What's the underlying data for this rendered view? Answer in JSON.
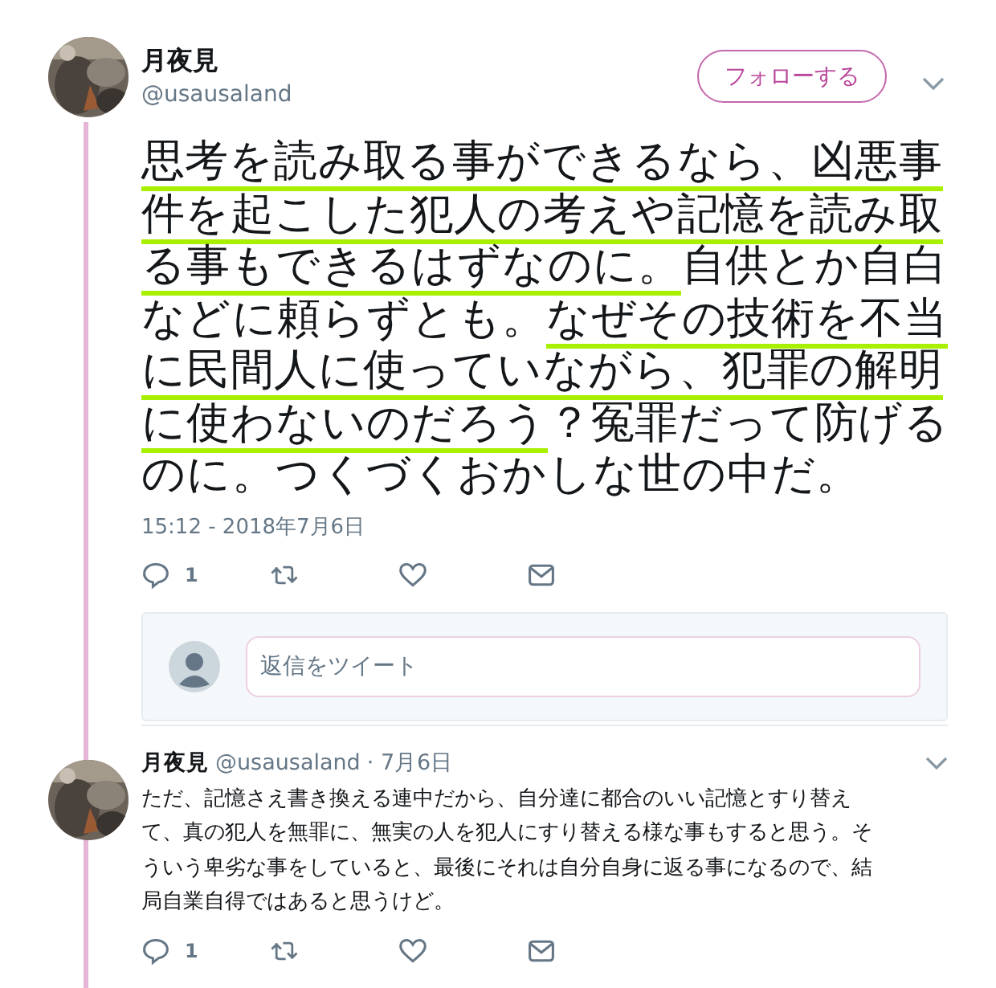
{
  "tweet": {
    "author": {
      "name": "月夜見",
      "handle": "@usausaland"
    },
    "follow_button": "フォローする",
    "text_lines": [
      [
        {
          "text": "思考を読み取る事ができるなら、凶悪事",
          "highlighted": true
        }
      ],
      [
        {
          "text": "件を起こした犯人の考えや記憶を読み取",
          "highlighted": true
        }
      ],
      [
        {
          "text": "る事もできるはずなのに。",
          "highlighted": true
        },
        {
          "text": "自供とか自白",
          "highlighted": false
        }
      ],
      [
        {
          "text": "などに頼らずとも。",
          "highlighted": false
        },
        {
          "text": "なぜその技術を不当",
          "highlighted": true
        }
      ],
      [
        {
          "text": "に民間人に使っていながら、犯罪の解明",
          "highlighted": true
        }
      ],
      [
        {
          "text": "に使わないのだろう",
          "highlighted": true
        },
        {
          "text": "？冤罪だって防げる",
          "highlighted": false
        }
      ],
      [
        {
          "text": "のに。つくづくおかしな世の中だ。",
          "highlighted": false
        }
      ]
    ],
    "timestamp": "15:12 - 2018年7月6日",
    "actions": {
      "reply_count": "1"
    },
    "reply_box": {
      "placeholder": "返信をツイート"
    }
  },
  "replies": [
    {
      "author": {
        "name": "月夜見",
        "handle": "@usausaland"
      },
      "date": "· 7月6日",
      "text_lines": [
        "ただ、記憶さえ書き換える連中だから、自分達に都合のいい記憶とすり替え",
        "て、真の犯人を無罪に、無実の人を犯人にすり替える様な事もすると思う。そ",
        "ういう卑劣な事をしていると、最後にそれは自分自身に返る事になるので、結",
        "局自業自得ではあると思うけど。"
      ],
      "reply_count": "1"
    }
  ]
}
